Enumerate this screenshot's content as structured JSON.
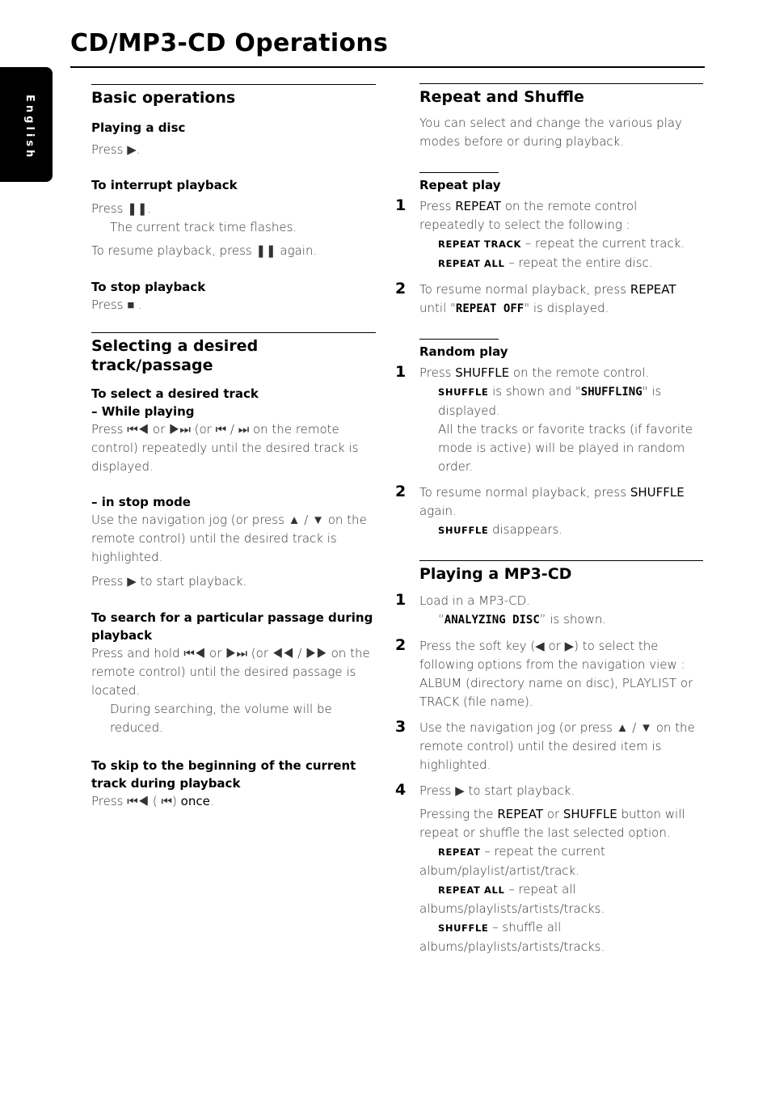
{
  "page": {
    "title": "CD/MP3-CD Operations",
    "language_tab": "English"
  },
  "left": {
    "basic": {
      "heading": "Basic operations",
      "playing_heading": "Playing a disc",
      "playing_text": "Press ▶.",
      "interrupt_heading": "To interrupt playback",
      "interrupt_text": "Press ❚❚.",
      "interrupt_note": "The current track time flashes.",
      "resume_text": "To resume playback, press ❚❚ again.",
      "stop_heading": "To stop playback",
      "stop_text": "Press ■ ."
    },
    "selecting": {
      "heading": "Selecting a desired track/passage",
      "select_heading": "To select a desired track",
      "while_playing": "–  While playing",
      "while_text": "Press ⏮◀ or ▶⏭ (or ⏮ / ⏭ on the remote control) repeatedly until the desired track is displayed.",
      "stop_mode": "–  in stop mode",
      "stop_mode_text": "Use the navigation jog (or press ▲ / ▼ on the remote control) until the desired track is highlighted.",
      "stop_mode_press": "Press ▶ to start playback.",
      "search_heading": "To search for a particular passage during playback",
      "search_text": "Press and hold ⏮◀ or ▶⏭ (or ◀◀ / ▶▶ on the remote control) until the desired passage is located.",
      "search_note": "During searching, the volume will be reduced.",
      "skip_heading": "To skip to the beginning of the current track during playback",
      "skip_text_pre": "Press ⏮◀  ( ⏮) ",
      "skip_text_bold": "once",
      "skip_text_post": "."
    }
  },
  "right": {
    "repeat_shuffle": {
      "heading": "Repeat and Shuffle",
      "intro": "You can select and change the various play modes before or during playback."
    },
    "repeat_play": {
      "heading": "Repeat play",
      "steps": [
        {
          "num": "1",
          "pre": "Press ",
          "bold": "REPEAT",
          "post": " on the remote control repeatedly to select the following :"
        },
        {
          "num": "2",
          "pre": "To resume normal playback, press ",
          "bold": "REPEAT",
          "post": ""
        }
      ],
      "options": [
        {
          "label": "REPEAT TRACK",
          "desc": " – repeat the current track."
        },
        {
          "label": "REPEAT ALL",
          "desc": " – repeat the entire disc."
        }
      ],
      "until_pre": "until \"",
      "until_lcd": "REPEAT  OFF",
      "until_post": "\" is displayed."
    },
    "random_play": {
      "heading": "Random play",
      "step1_pre": "Press ",
      "step1_bold": "SHUFFLE",
      "step1_post": " on the remote control.",
      "step1_label": "SHUFFLE",
      "step1_shown": " is shown and \"",
      "step1_lcd": "SHUFFLING",
      "step1_disp": "\" is displayed.",
      "step1_note": "All the tracks or favorite tracks (if favorite mode is active) will be played in random order.",
      "step2_pre": "To resume normal playback, press ",
      "step2_bold": "SHUFFLE",
      "step2_post": " again.",
      "step2_label": "SHUFFLE",
      "step2_note": " disappears.",
      "num1": "1",
      "num2": "2"
    },
    "mp3": {
      "heading": "Playing a MP3-CD",
      "step1": "Load in a MP3-CD.",
      "step1_q1": "“",
      "step1_lcd": "ANALYZING DISC",
      "step1_q2": "” is shown.",
      "step2": "Press the soft key (◀ or ▶) to select the following options from the navigation view :  ALBUM (directory name on disc), PLAYLIST or TRACK (file name).",
      "step3": "Use the navigation jog (or press ▲ / ▼ on the remote control) until the desired item is highlighted.",
      "step4": "Press ▶ to start playback.",
      "num1": "1",
      "num2": "2",
      "num3": "3",
      "num4": "4",
      "note_pre": "Pressing the ",
      "note_b1": "REPEAT",
      "note_mid": " or ",
      "note_b2": "SHUFFLE",
      "note_post": " button will repeat or shuffle the last selected option.",
      "options": [
        {
          "label": "REPEAT",
          "desc": "  – repeat the current album/playlist/artist/track."
        },
        {
          "label": "REPEAT ALL",
          "desc": "  – repeat all albums/playlists/artists/tracks."
        },
        {
          "label": "SHUFFLE",
          "desc": "  – shuffle all albums/playlists/artists/tracks."
        }
      ]
    }
  }
}
